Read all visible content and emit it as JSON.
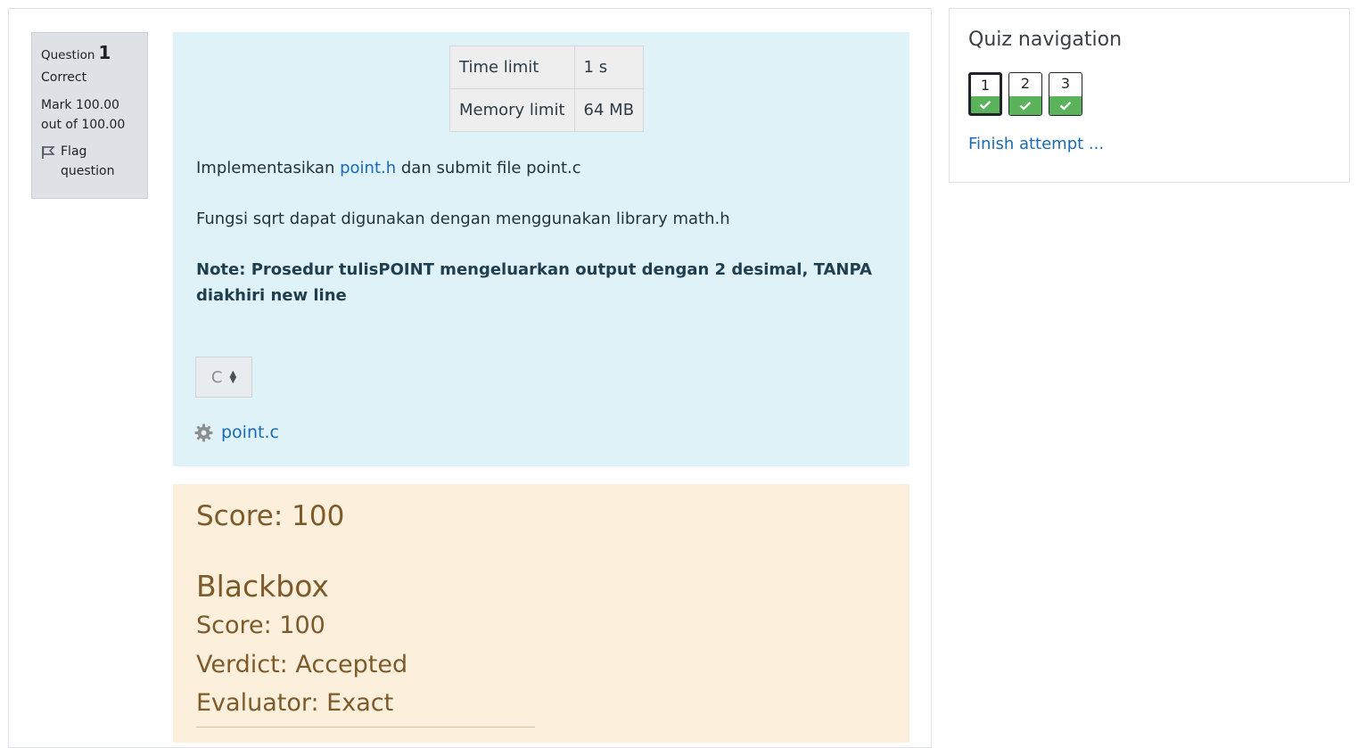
{
  "question_info": {
    "label": "Question",
    "number": "1",
    "state": "Correct",
    "grade": "Mark 100.00 out of 100.00",
    "flag_label": "Flag question"
  },
  "limits": {
    "time_label": "Time limit",
    "time_value": "1 s",
    "memory_label": "Memory limit",
    "memory_value": "64 MB"
  },
  "description": {
    "line1_prefix": "Implementasikan ",
    "line1_link": "point.h",
    "line1_suffix": " dan submit file point.c",
    "line2": "Fungsi sqrt dapat digunakan dengan menggunakan library math.h",
    "note": "Note: Prosedur tulisPOINT mengeluarkan output dengan 2 desimal, TANPA diakhiri new line"
  },
  "language_select": {
    "selected": "C"
  },
  "submitted_file": {
    "name": "point.c",
    "icon": "gear-icon"
  },
  "outcome": {
    "score_heading": "Score: 100",
    "blackbox_title": "Blackbox",
    "score_line": "Score: 100",
    "verdict_line": "Verdict: Accepted",
    "evaluator_line": "Evaluator: Exact"
  },
  "quiz_nav": {
    "title": "Quiz navigation",
    "questions": [
      "1",
      "2",
      "3"
    ],
    "finish_label": "Finish attempt ..."
  },
  "colors": {
    "formulation_bg": "#def2f8",
    "outcome_bg": "#fcefdc",
    "correct_green": "#5ab35a",
    "link_blue": "#1a6ab5"
  }
}
